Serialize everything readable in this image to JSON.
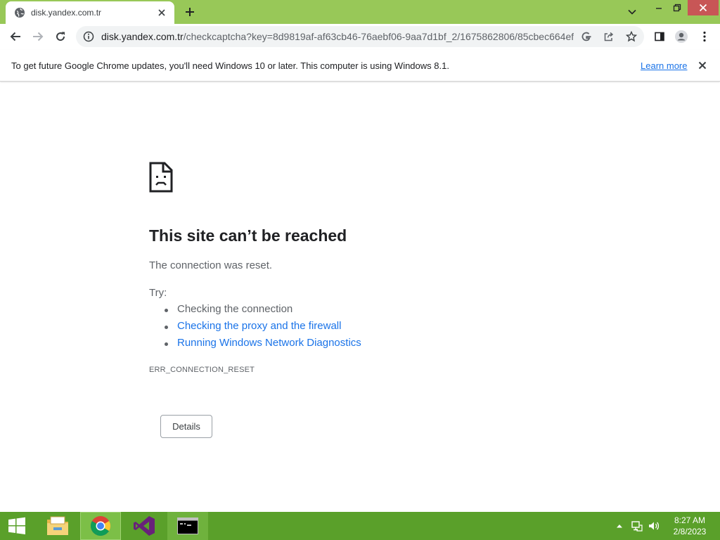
{
  "browser": {
    "tab": {
      "title": "disk.yandex.com.tr",
      "favicon": "globe-icon"
    },
    "url": {
      "host": "disk.yandex.com.tr",
      "path": "/checkcaptcha?key=8d9819af-af63cb46-76aebf06-9aa7d1bf_2/1675862806/85cbec664ef..."
    },
    "colors": {
      "frame": "#98c858",
      "close_hover": "#c85656"
    }
  },
  "infobar": {
    "message": "To get future Google Chrome updates, you'll need Windows 10 or later. This computer is using Windows 8.1.",
    "link": "Learn more"
  },
  "error": {
    "title": "This site can’t be reached",
    "subtitle": "The connection was reset.",
    "try_label": "Try:",
    "suggestions": [
      {
        "text": "Checking the connection",
        "is_link": false
      },
      {
        "text": "Checking the proxy and the firewall",
        "is_link": true
      },
      {
        "text": "Running Windows Network Diagnostics",
        "is_link": true
      }
    ],
    "code": "ERR_CONNECTION_RESET",
    "details_button": "Details"
  },
  "taskbar": {
    "color": "#5aa02a",
    "apps": [
      "windows-start-icon",
      "file-explorer-icon",
      "chrome-icon",
      "visual-studio-icon",
      "command-prompt-icon"
    ],
    "clock": {
      "time": "8:27 AM",
      "date": "2/8/2023"
    }
  }
}
